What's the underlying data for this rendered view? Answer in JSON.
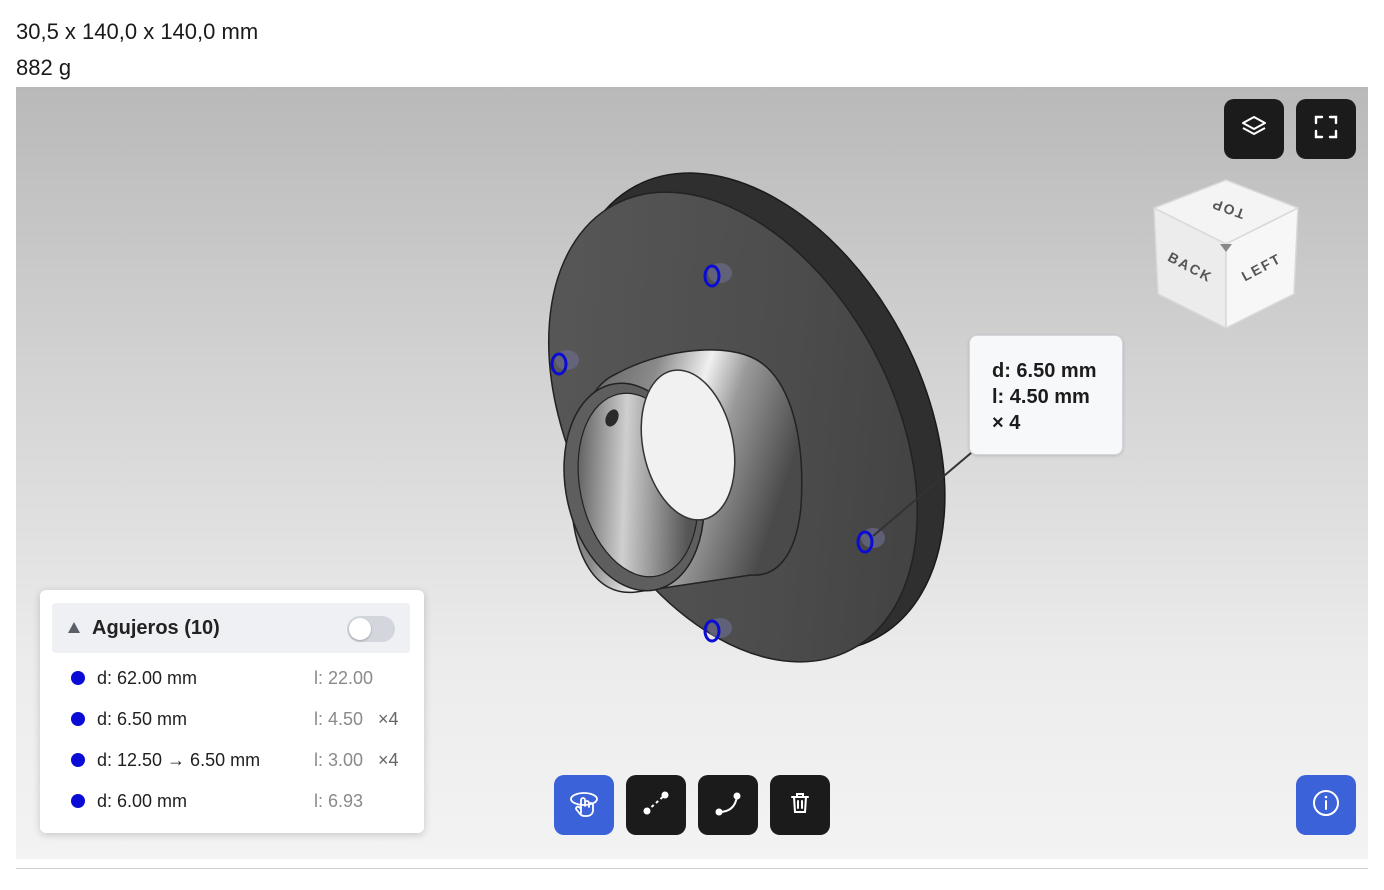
{
  "header": {
    "dimensions": "30,5 x 140,0 x 140,0 mm",
    "weight": "882 g"
  },
  "viewcube": {
    "faces": [
      "TOP",
      "BACK",
      "LEFT"
    ]
  },
  "callout": {
    "line1": "d: 6.50 mm",
    "line2": "l: 4.50 mm",
    "line3": "× 4"
  },
  "holes_panel": {
    "title": "Agujeros (10)",
    "toggle_on": false,
    "items": [
      {
        "d": "d: 62.00 mm",
        "l": "l: 22.00",
        "count": ""
      },
      {
        "d": "d: 6.50 mm",
        "l": "l: 4.50",
        "count": "×4"
      },
      {
        "d": "d: 12.50 → 6.50 mm",
        "l": "l: 3.00",
        "count": "×4"
      },
      {
        "d": "d: 6.00 mm",
        "l": "l: 6.93",
        "count": ""
      }
    ]
  },
  "toolbar": {
    "buttons": [
      "rotate-hand-icon",
      "measure-distance-icon",
      "measure-curve-icon",
      "trash-icon"
    ],
    "active": "rotate-hand-icon"
  },
  "top_buttons": [
    "layers-icon",
    "fullscreen-icon"
  ],
  "info_button": "info-icon",
  "colors": {
    "accent": "#3b62d8",
    "hole_highlight": "#0b0bd6",
    "button_dark": "#1b1b1b"
  }
}
